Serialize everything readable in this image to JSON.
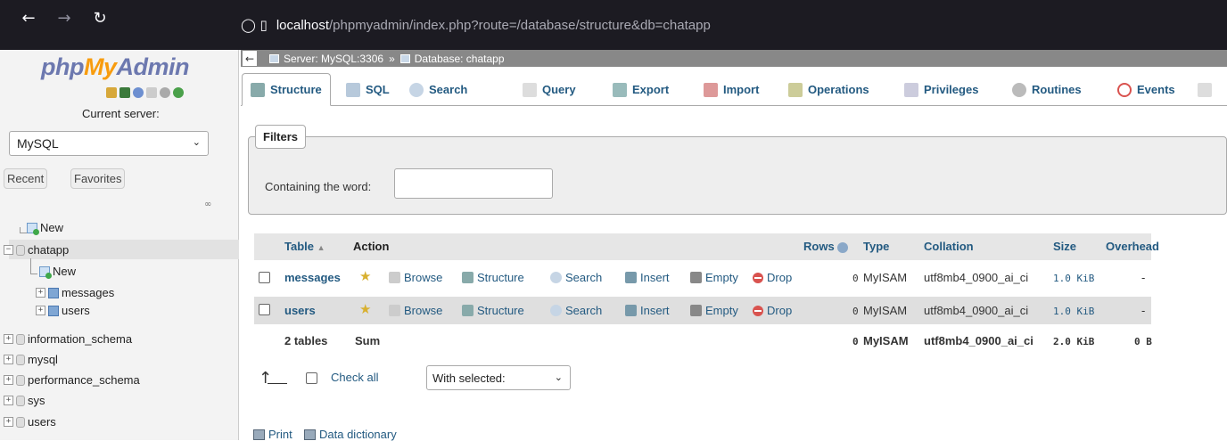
{
  "browser": {
    "url_host": "localhost",
    "url_path": "/phpmyadmin/index.php?route=/database/structure&db=chatapp"
  },
  "sidebar": {
    "logo": {
      "php": "php",
      "my": "My",
      "admin": "Admin"
    },
    "current_server_label": "Current server:",
    "server_selected": "MySQL",
    "recent_label": "Recent",
    "favorites_label": "Favorites",
    "tree": {
      "new_root": "New",
      "db_chatapp": "chatapp",
      "chatapp_new": "New",
      "table_messages": "messages",
      "table_users": "users",
      "db_information_schema": "information_schema",
      "db_mysql": "mysql",
      "db_performance_schema": "performance_schema",
      "db_sys": "sys",
      "db_users": "users"
    }
  },
  "breadcrumb": {
    "server": "Server: MySQL:3306",
    "separator": "»",
    "database": "Database: chatapp"
  },
  "tabs": [
    "Structure",
    "SQL",
    "Search",
    "Query",
    "Export",
    "Import",
    "Operations",
    "Privileges",
    "Routines",
    "Events"
  ],
  "filters": {
    "legend": "Filters",
    "containing_label": "Containing the word:",
    "input_value": ""
  },
  "table": {
    "headers": {
      "table": "Table",
      "action": "Action",
      "rows": "Rows",
      "type": "Type",
      "collation": "Collation",
      "size": "Size",
      "overhead": "Overhead"
    },
    "actions": {
      "browse": "Browse",
      "structure": "Structure",
      "search": "Search",
      "insert": "Insert",
      "empty": "Empty",
      "drop": "Drop"
    },
    "rows": [
      {
        "name": "messages",
        "rows": "0",
        "type": "MyISAM",
        "collation": "utf8mb4_0900_ai_ci",
        "size": "1.0 KiB",
        "overhead": "-"
      },
      {
        "name": "users",
        "rows": "0",
        "type": "MyISAM",
        "collation": "utf8mb4_0900_ai_ci",
        "size": "1.0 KiB",
        "overhead": "-"
      }
    ],
    "sum": {
      "tables": "2 tables",
      "label": "Sum",
      "rows": "0",
      "type": "MyISAM",
      "collation": "utf8mb4_0900_ai_ci",
      "size": "2.0 KiB",
      "overhead": "0 B"
    }
  },
  "footer": {
    "check_all": "Check all",
    "with_selected": "With selected:",
    "print": "Print",
    "data_dictionary": "Data dictionary"
  },
  "colors": {
    "link": "#235a81",
    "logo_blue": "#6c78af",
    "logo_orange": "#f89c0e"
  }
}
